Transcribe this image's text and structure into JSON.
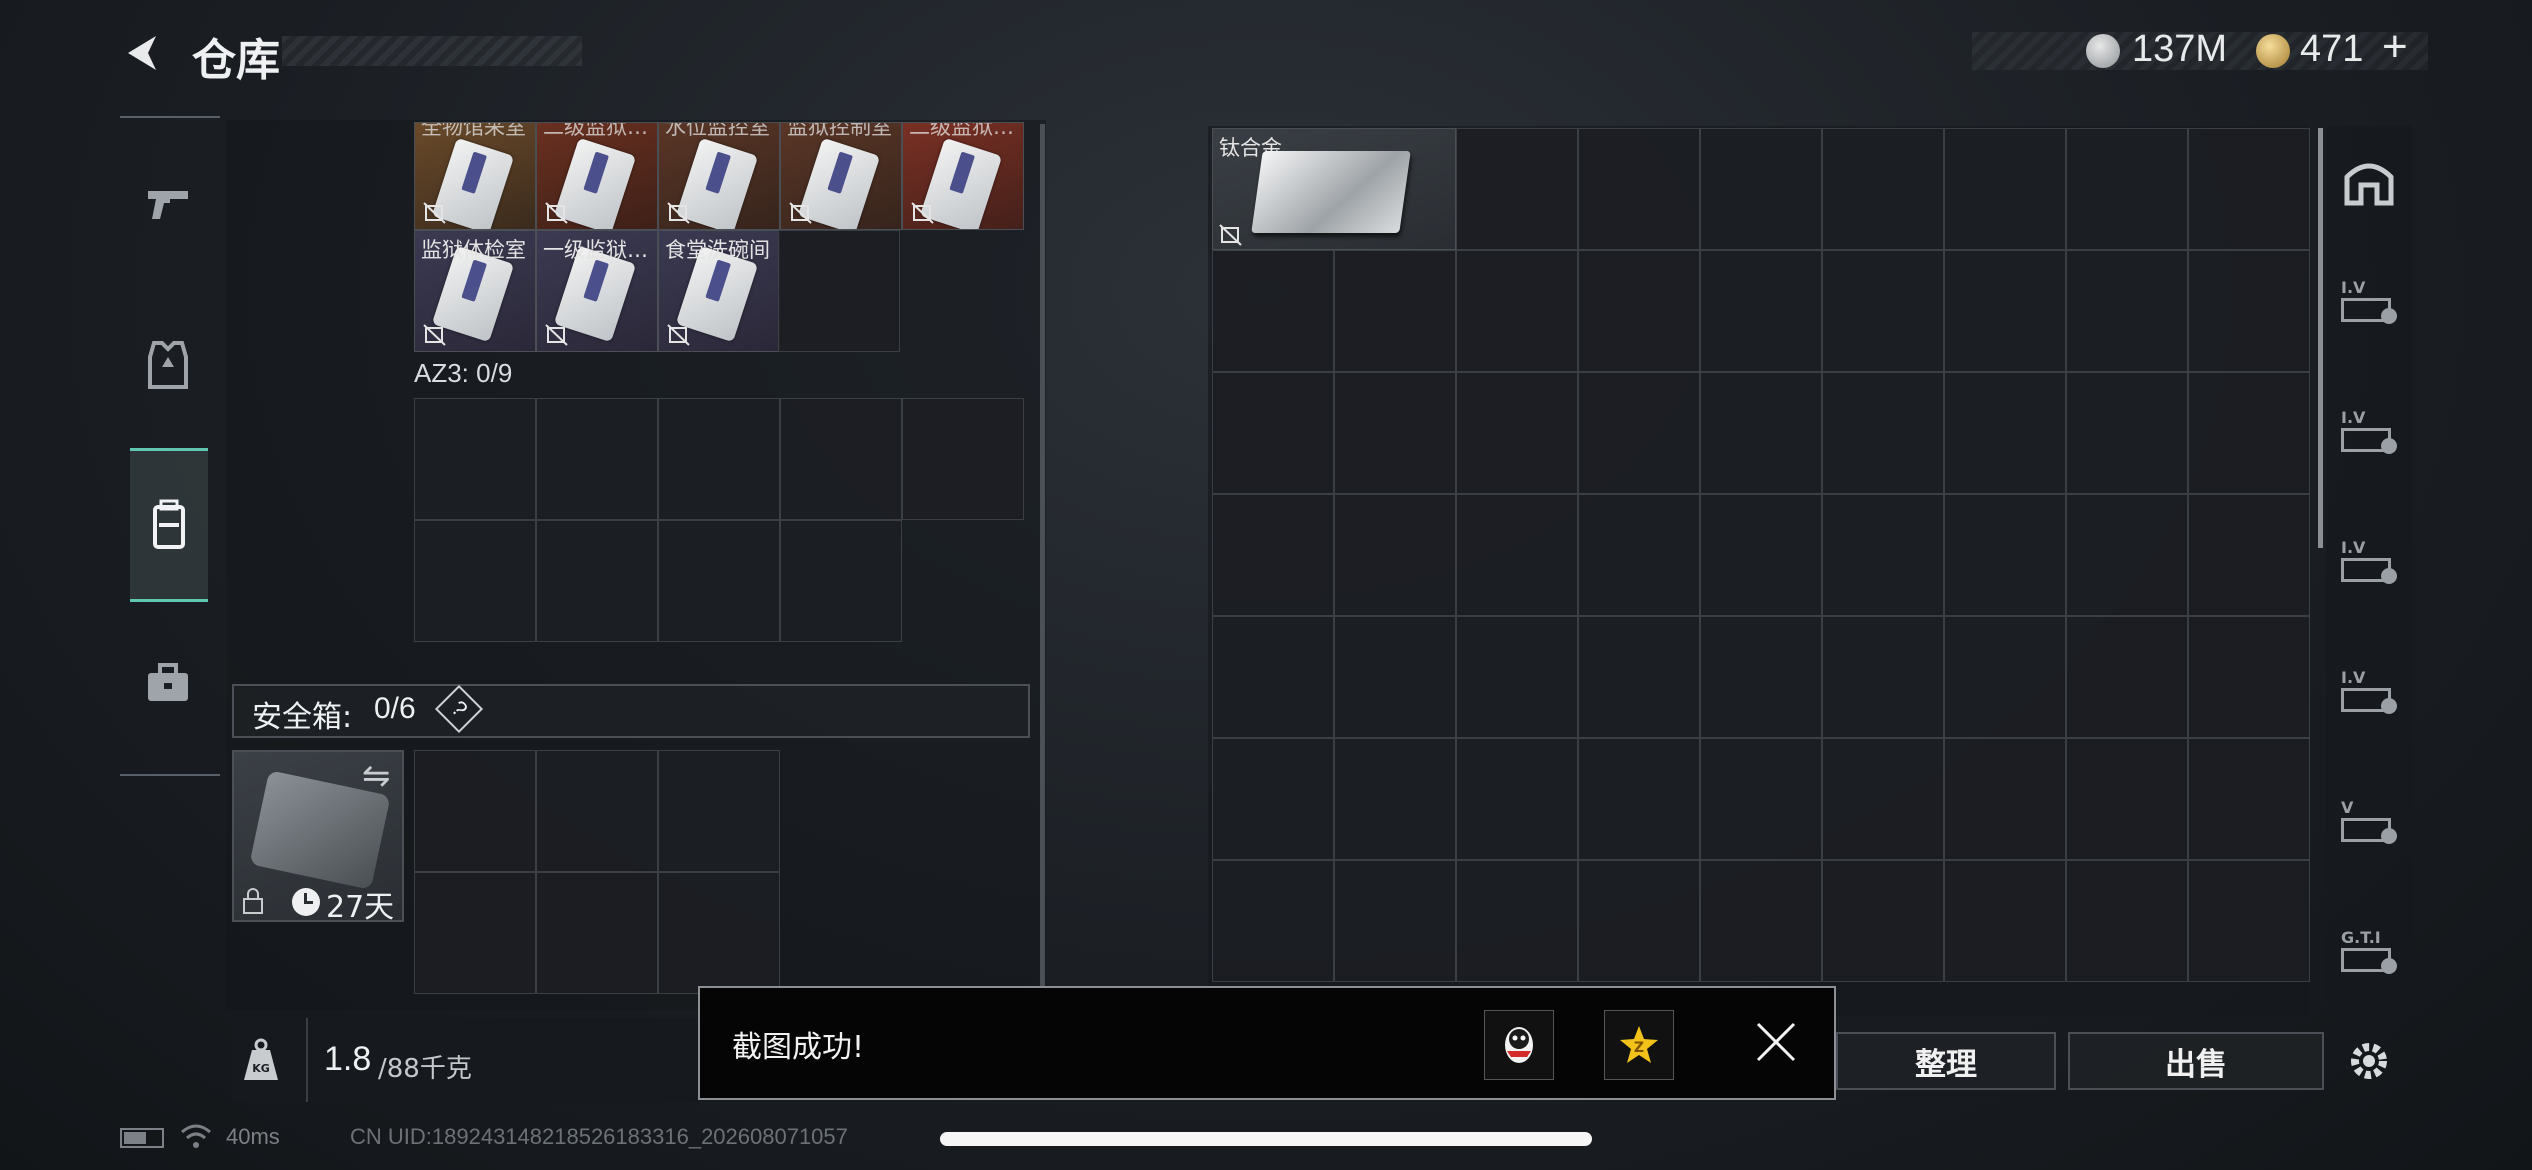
{
  "header": {
    "title": "仓库",
    "currency_silver": "137M",
    "currency_gold": "471",
    "currency_gold_add": "+"
  },
  "sidebar": {
    "tabs": [
      {
        "icon": "pistol-icon"
      },
      {
        "icon": "armor-vest-icon"
      },
      {
        "icon": "backpack-icon",
        "active": true
      },
      {
        "icon": "briefcase-icon"
      }
    ]
  },
  "left": {
    "top_items": [
      "全物馆采室",
      "二级监狱…",
      "水位监控室",
      "监狱控制室",
      "二级监狱…"
    ],
    "second_row_items": [
      "监狱体检室",
      "一级监狱…",
      "食堂洗碗间"
    ],
    "az3_label": "AZ3: 0/9",
    "safebox_label": "安全箱:",
    "safebox_count": "0/6",
    "safebox_help": "?",
    "safebox_days": "27天",
    "weight_value": "1.8",
    "weight_total": "/88千克"
  },
  "right": {
    "items": [
      {
        "name": "钛合金"
      }
    ]
  },
  "buttons": {
    "sort": "整理",
    "sell": "出售"
  },
  "toast": {
    "message": "截图成功!"
  },
  "status": {
    "ping": "40ms",
    "uid": "CN UID:18924314821852618331​6_202608071057"
  },
  "right_rail": [
    {
      "icon": "vault-home-icon"
    },
    {
      "icon": "storage-iv-icon",
      "label": "I.V"
    },
    {
      "icon": "storage-iv-icon",
      "label": "I.V"
    },
    {
      "icon": "storage-iv-icon",
      "label": "I.V"
    },
    {
      "icon": "storage-iv-icon",
      "label": "I.V"
    },
    {
      "icon": "storage-v-icon",
      "label": "V"
    },
    {
      "icon": "storage-gti-icon",
      "label": "G.T.I"
    },
    {
      "icon": "settings-gear-icon"
    }
  ],
  "colors": {
    "accent_teal": "#5fc6b0",
    "gold_row_bg": "#5a3a24",
    "purple_row_bg": "#3a3650"
  }
}
